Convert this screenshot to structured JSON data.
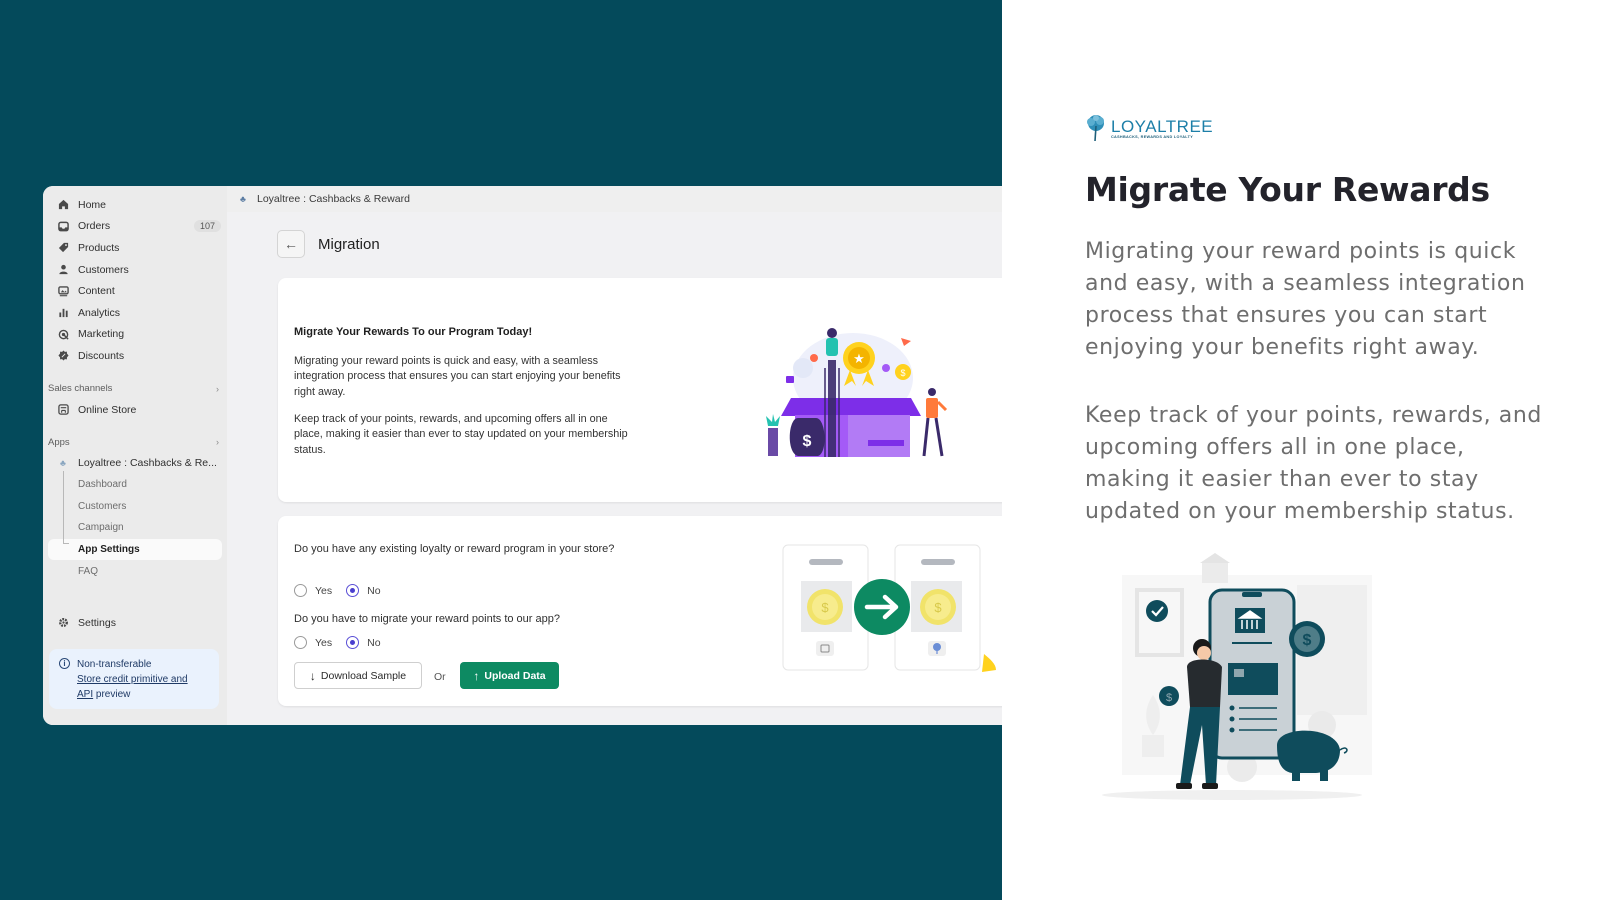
{
  "sidebar": {
    "items": [
      {
        "label": "Home",
        "icon": "home-icon"
      },
      {
        "label": "Orders",
        "icon": "inbox-icon",
        "badge": "107"
      },
      {
        "label": "Products",
        "icon": "tag-icon"
      },
      {
        "label": "Customers",
        "icon": "person-icon"
      },
      {
        "label": "Content",
        "icon": "image-icon"
      },
      {
        "label": "Analytics",
        "icon": "bar-chart-icon"
      },
      {
        "label": "Marketing",
        "icon": "target-icon"
      },
      {
        "label": "Discounts",
        "icon": "discount-icon"
      }
    ],
    "sales_channels_label": "Sales channels",
    "online_store_label": "Online Store",
    "apps_label": "Apps",
    "app_name": "Loyaltree : Cashbacks & Re...",
    "app_subitems": [
      "Dashboard",
      "Customers",
      "Campaign",
      "App Settings",
      "FAQ"
    ],
    "active_subitem": "App Settings",
    "settings_label": "Settings",
    "notice": {
      "title": "Non-transferable",
      "link_line1": "Store credit primitive and",
      "link_api": "API",
      "suffix": " preview"
    }
  },
  "header": {
    "breadcrumb": "Loyaltree : Cashbacks & Reward",
    "page_title": "Migration",
    "back_icon": "arrow-left-icon"
  },
  "intro_card": {
    "title": "Migrate Your Rewards To our Program Today!",
    "paragraph1": "Migrating your reward points is quick and easy, with a seamless integration process that ensures you can start enjoying your benefits right away.",
    "paragraph2": "Keep track of your points, rewards, and upcoming offers all in one place, making it easier than ever to stay updated on your membership status."
  },
  "form_card": {
    "question1": "Do you have any existing loyalty or reward program in your store?",
    "question2": "Do you have to migrate your reward points to our app?",
    "yes_label": "Yes",
    "no_label": "No",
    "q1_selected": "No",
    "q2_selected": "No",
    "download_label": "Download Sample",
    "or_label": "Or",
    "upload_label": "Upload Data"
  },
  "promo": {
    "logo_name": "LOYALTREE",
    "logo_tagline": "CASHBACKS, REWARDS AND LOYALTY",
    "title": "Migrate Your Rewards",
    "paragraph1": "Migrating your reward points is quick and easy, with a seamless integration process that ensures you can start enjoying your benefits right away.",
    "paragraph2": "Keep track of your points, rewards, and upcoming offers all in one place, making it easier than ever to stay updated on your membership status."
  },
  "colors": {
    "background_teal": "#044a5b",
    "primary_green": "#0d8a62",
    "radio_selected": "#4a3fcf",
    "brand_blue": "#1d7fa8"
  }
}
